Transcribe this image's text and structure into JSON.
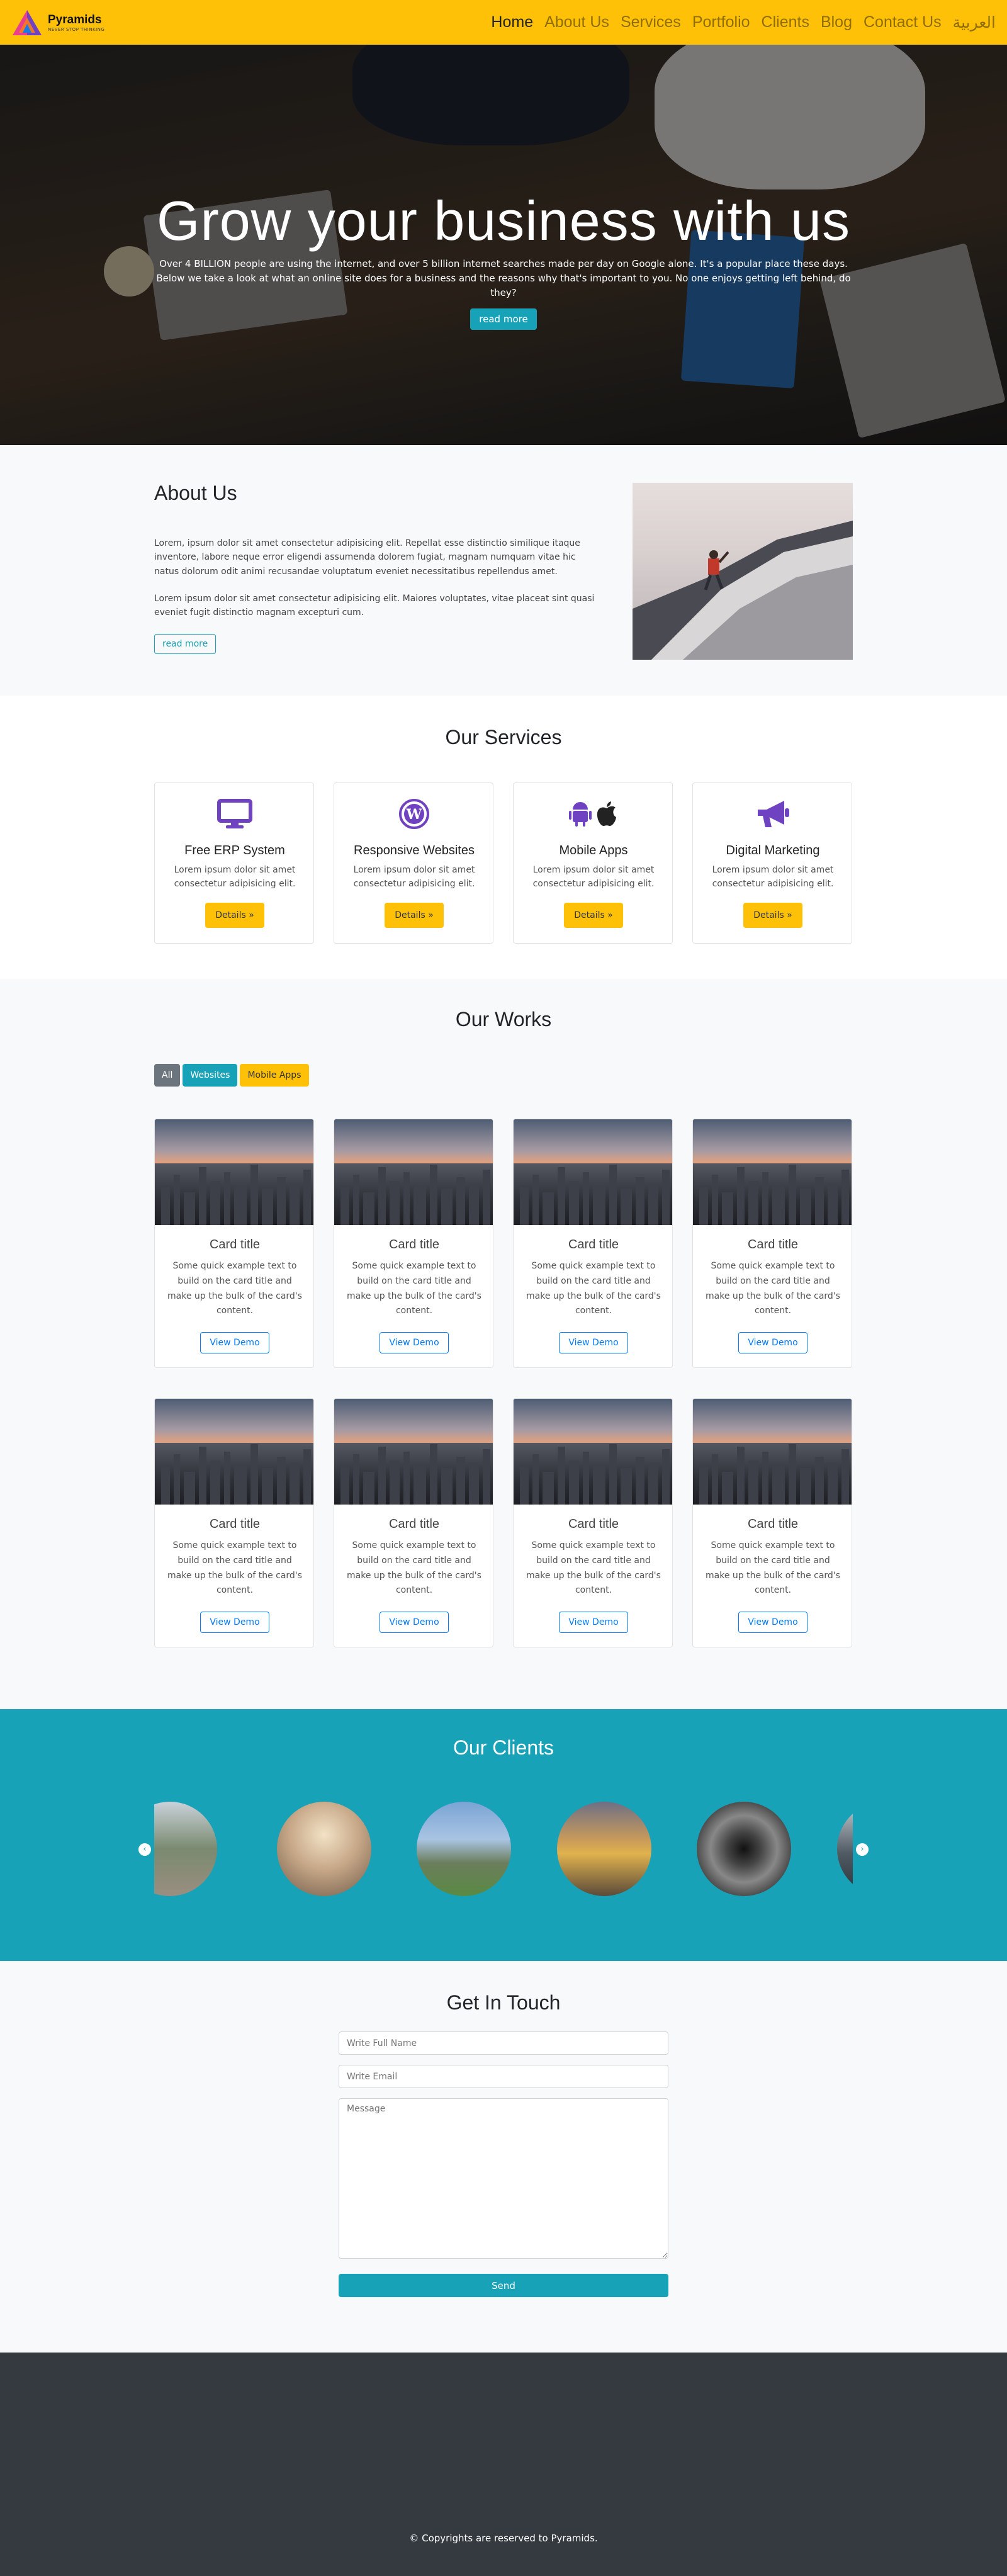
{
  "brand": {
    "name": "Pyramids",
    "tagline": "NEVER STOP THINKING",
    "colors": {
      "accent": "#ffc107",
      "teal": "#17a2b8",
      "purple": "#6f42c1",
      "dark": "#343a40"
    }
  },
  "nav": {
    "items": [
      "Home",
      "About Us",
      "Services",
      "Portfolio",
      "Clients",
      "Blog",
      "Contact Us",
      "العربية"
    ]
  },
  "hero": {
    "title": "Grow your business with us",
    "text": "Over 4 BILLION people are using the internet, and over 5 billion internet searches made per day on Google alone. It's a popular place these days. Below we take a look at what an online site does for a business and the reasons why that's important to you. No one enjoys getting left behind, do they?",
    "button": "read more"
  },
  "about": {
    "title": "About Us",
    "p1": "Lorem, ipsum dolor sit amet consectetur adipisicing elit. Repellat esse distinctio similique itaque inventore, labore neque error eligendi assumenda dolorem fugiat, magnam numquam vitae hic natus dolorum odit animi recusandae voluptatum eveniet necessitatibus repellendus amet.",
    "p2": "Lorem ipsum dolor sit amet consectetur adipisicing elit. Maiores voluptates, vitae placeat sint quasi eveniet fugit distinctio magnam excepturi cum.",
    "button": "read more"
  },
  "services": {
    "title": "Our Services",
    "items": [
      {
        "icon": "desktop-icon",
        "title": "Free ERP System",
        "text": "Lorem ipsum dolor sit amet consectetur adipisicing elit.",
        "button": "Details »"
      },
      {
        "icon": "wordpress-icon",
        "title": "Responsive Websites",
        "text": "Lorem ipsum dolor sit amet consectetur adipisicing elit.",
        "button": "Details »"
      },
      {
        "icon": "android-apple-icon",
        "title": "Mobile Apps",
        "text": "Lorem ipsum dolor sit amet consectetur adipisicing elit.",
        "button": "Details »"
      },
      {
        "icon": "megaphone-icon",
        "title": "Digital Marketing",
        "text": "Lorem ipsum dolor sit amet consectetur adipisicing elit.",
        "button": "Details »"
      }
    ]
  },
  "works": {
    "title": "Our Works",
    "filters": [
      "All",
      "Websites",
      "Mobile Apps"
    ],
    "card": {
      "title": "Card title",
      "text": "Some quick example text to build on the card title and make up the bulk of the card's content.",
      "button": "View Demo"
    },
    "count": 8
  },
  "clients": {
    "title": "Our Clients",
    "prev": "‹",
    "next": "›"
  },
  "contact": {
    "title": "Get In Touch",
    "name_placeholder": "Write Full Name",
    "email_placeholder": "Write Email",
    "message_placeholder": "Message",
    "button": "Send"
  },
  "footer": {
    "text": "© Copyrights are reserved to Pyramids."
  }
}
